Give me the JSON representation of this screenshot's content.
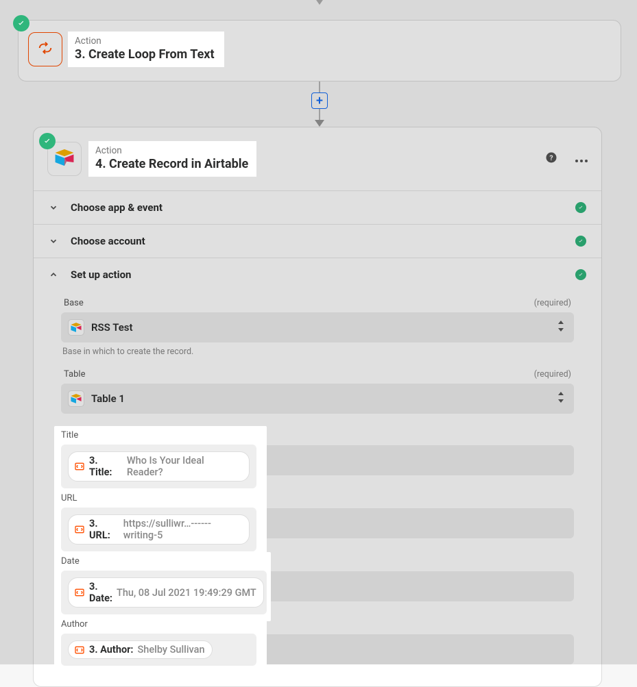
{
  "connector": {
    "plus": "+"
  },
  "step3": {
    "label": "Action",
    "title": "3. Create Loop From Text"
  },
  "step4": {
    "label": "Action",
    "title": "4. Create Record in Airtable",
    "sections": {
      "app_event": "Choose app & event",
      "account": "Choose account",
      "setup": "Set up action"
    },
    "form": {
      "base": {
        "label": "Base",
        "required": "(required)",
        "value": "RSS Test",
        "help": "Base in which to create the record."
      },
      "table": {
        "label": "Table",
        "required": "(required)",
        "value": "Table 1"
      },
      "title": {
        "label": "Title",
        "token_prefix": "3. Title:",
        "token_value": "Who Is Your Ideal Reader?"
      },
      "url": {
        "label": "URL",
        "token_prefix": "3. URL:",
        "token_value": "https://sulliwr…------writing-5"
      },
      "date": {
        "label": "Date",
        "token_prefix": "3. Date:",
        "token_value": "Thu, 08 Jul 2021 19:49:29 GMT"
      },
      "author": {
        "label": "Author",
        "token_prefix": "3. Author:",
        "token_value": "Shelby Sullivan"
      }
    }
  }
}
